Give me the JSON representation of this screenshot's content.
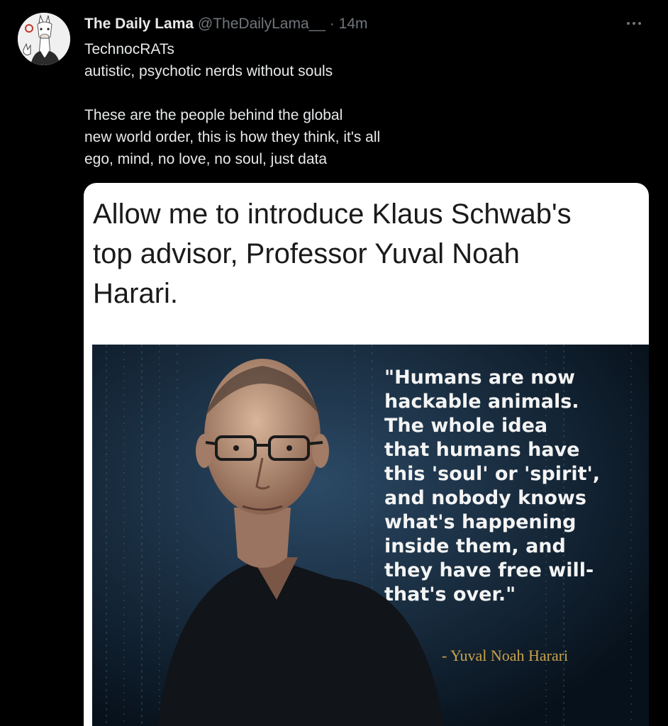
{
  "tweet": {
    "display_name": "The Daily Lama",
    "handle": "@TheDailyLama__",
    "separator": "·",
    "time": "14m",
    "text_lines": [
      "TechnocRATs",
      "autistic, psychotic nerds without souls",
      "These are the people behind the global",
      "new world order, this is how they think, it's all",
      "ego, mind, no love, no soul, just data"
    ],
    "avatar_icon": "llama-icon",
    "more_icon": "more-options-icon"
  },
  "media": {
    "headline": "Allow me to introduce Klaus Schwab's\ntop advisor, Professor Yuval Noah\nHarari.",
    "quote_lines": [
      "\"Humans are now",
      "hackable animals.",
      "The whole idea",
      "that humans have",
      "this 'soul' or 'spirit',",
      "and nobody knows",
      "what's happening",
      "inside them, and",
      "they have free will-",
      "that's over.\""
    ],
    "attribution": "- Yuval Noah Harari"
  },
  "colors": {
    "background": "#000000",
    "primary_text": "#e7e9ea",
    "secondary_text": "#71767b",
    "attribution": "#c9a24a"
  }
}
